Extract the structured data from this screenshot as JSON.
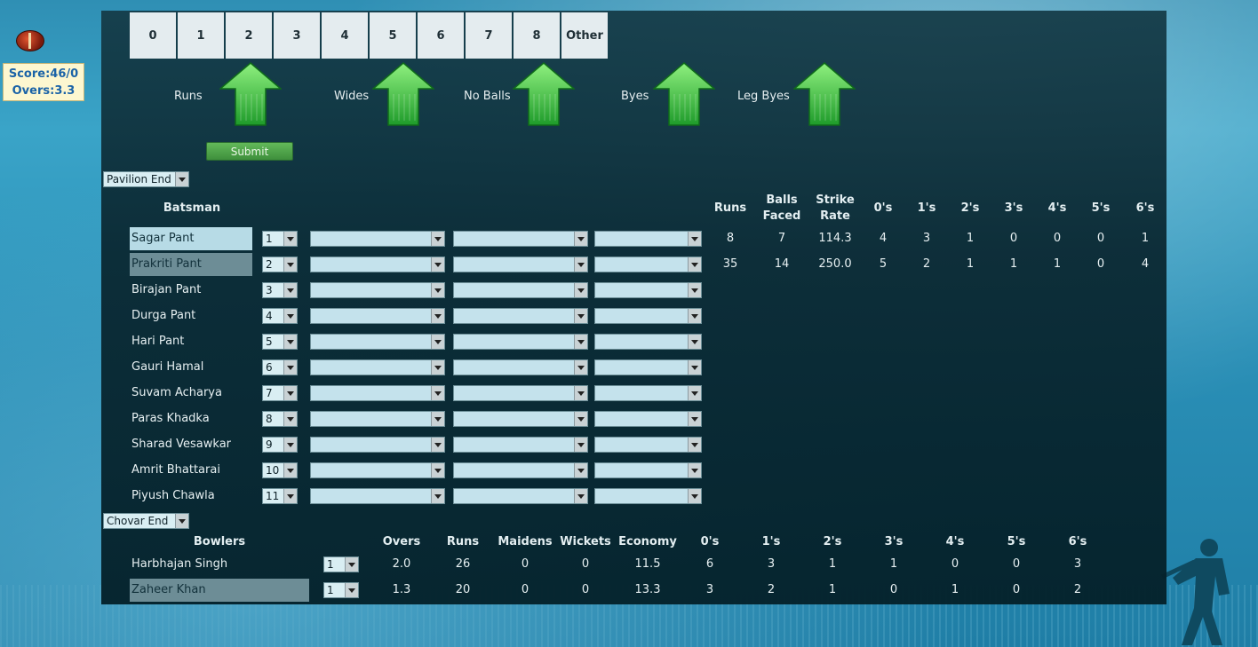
{
  "score": {
    "score_text": "Score:46/0",
    "overs_text": "Overs:3.3"
  },
  "run_buttons": [
    "0",
    "1",
    "2",
    "3",
    "4",
    "5",
    "6",
    "7",
    "8",
    "Other"
  ],
  "extras_labels": [
    "Runs",
    "Wides",
    "No Balls",
    "Byes",
    "Leg Byes"
  ],
  "submit_label": "Submit",
  "batting_end": "Pavilion End",
  "bowling_end": "Chovar End",
  "batting_headers": {
    "batsman": "Batsman",
    "runs": "Runs",
    "balls_faced": "Balls Faced",
    "strike_rate": "Strike Rate",
    "zeros": "0's",
    "ones": "1's",
    "twos": "2's",
    "threes": "3's",
    "fours": "4's",
    "fives": "5's",
    "sixes": "6's"
  },
  "batsmen": [
    {
      "name": "Sagar Pant",
      "order": "1",
      "runs": "8",
      "balls": "7",
      "sr": "114.3",
      "c0": "4",
      "c1": "3",
      "c2": "1",
      "c3": "0",
      "c4": "0",
      "c5": "0",
      "c6": "1"
    },
    {
      "name": "Prakriti Pant",
      "order": "2",
      "runs": "35",
      "balls": "14",
      "sr": "250.0",
      "c0": "5",
      "c1": "2",
      "c2": "1",
      "c3": "1",
      "c4": "1",
      "c5": "0",
      "c6": "4"
    },
    {
      "name": "Birajan Pant",
      "order": "3"
    },
    {
      "name": "Durga Pant",
      "order": "4"
    },
    {
      "name": "Hari Pant",
      "order": "5"
    },
    {
      "name": "Gauri Hamal",
      "order": "6"
    },
    {
      "name": "Suvam Acharya",
      "order": "7"
    },
    {
      "name": "Paras Khadka",
      "order": "8"
    },
    {
      "name": "Sharad Vesawkar",
      "order": "9"
    },
    {
      "name": "Amrit Bhattarai",
      "order": "10"
    },
    {
      "name": "Piyush Chawla",
      "order": "11"
    }
  ],
  "bowling_headers": {
    "bowlers": "Bowlers",
    "overs": "Overs",
    "runs": "Runs",
    "maidens": "Maidens",
    "wickets": "Wickets",
    "economy": "Economy",
    "zeros": "0's",
    "ones": "1's",
    "twos": "2's",
    "threes": "3's",
    "fours": "4's",
    "fives": "5's",
    "sixes": "6's"
  },
  "bowlers": [
    {
      "name": "Harbhajan Singh",
      "sel": "1",
      "overs": "2.0",
      "runs": "26",
      "maidens": "0",
      "wickets": "0",
      "economy": "11.5",
      "c0": "6",
      "c1": "3",
      "c2": "1",
      "c3": "1",
      "c4": "0",
      "c5": "0",
      "c6": "3"
    },
    {
      "name": "Zaheer Khan",
      "sel": "1",
      "overs": "1.3",
      "runs": "20",
      "maidens": "0",
      "wickets": "0",
      "economy": "13.3",
      "c0": "3",
      "c1": "2",
      "c2": "1",
      "c3": "0",
      "c4": "1",
      "c5": "0",
      "c6": "2"
    }
  ]
}
